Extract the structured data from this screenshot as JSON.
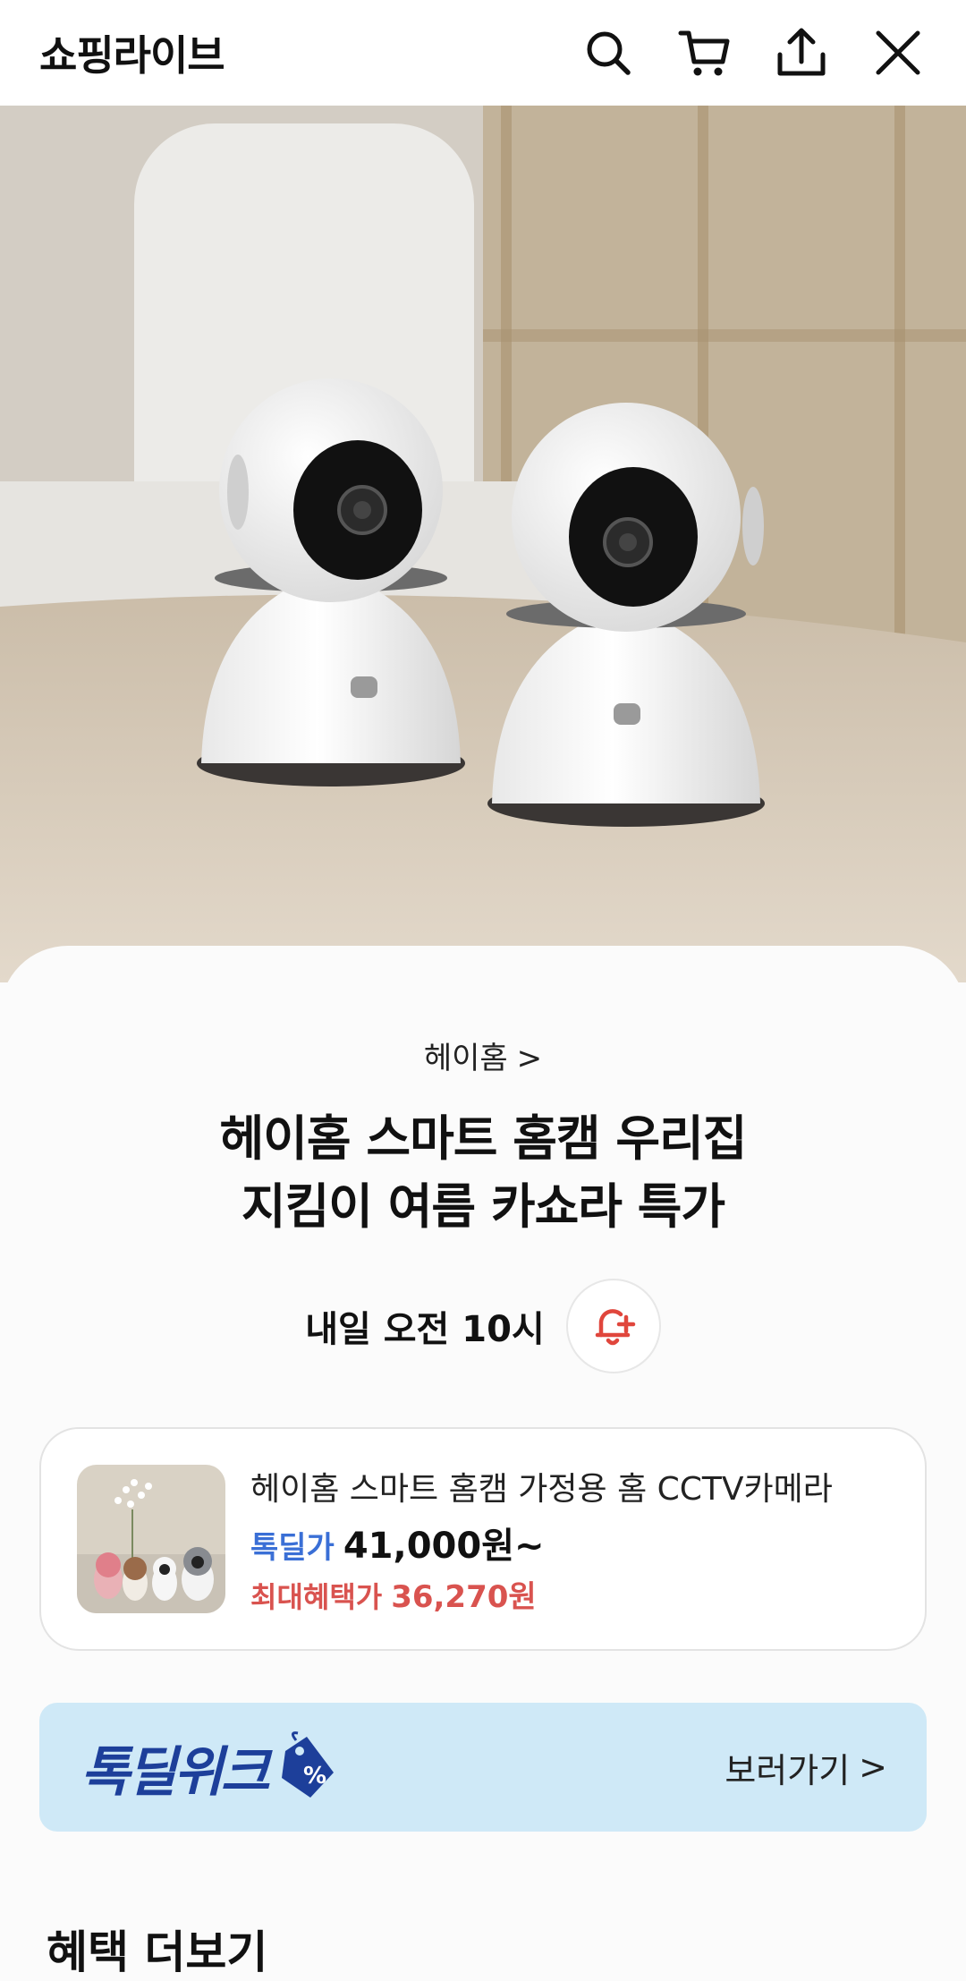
{
  "header": {
    "title": "쇼핑라이브",
    "actions": [
      "search-icon",
      "cart-icon",
      "share-icon",
      "close-icon"
    ]
  },
  "live": {
    "brand": "헤이홈",
    "brand_chevron": ">",
    "title_line1": "헤이홈 스마트 홈캠 우리집",
    "title_line2": "지킴이 여름 카쇼라 특가",
    "schedule": "내일 오전 10시"
  },
  "product": {
    "name": "헤이홈 스마트 홈캠 가정용 홈 CCTV카메라",
    "price_label": "톡딜가",
    "price": "41,000원~",
    "benefit_label": "최대혜택가",
    "benefit_price": "36,270원"
  },
  "banner": {
    "logo_text": "톡딜위크",
    "link_label": "보러가기",
    "link_chevron": ">"
  },
  "next_section_title": "혜택 더보기",
  "colors": {
    "accent_blue": "#3a6fd6",
    "benefit_red": "#d9534f",
    "alarm_red": "#e0463c",
    "banner_bg": "#cfe9f7"
  }
}
